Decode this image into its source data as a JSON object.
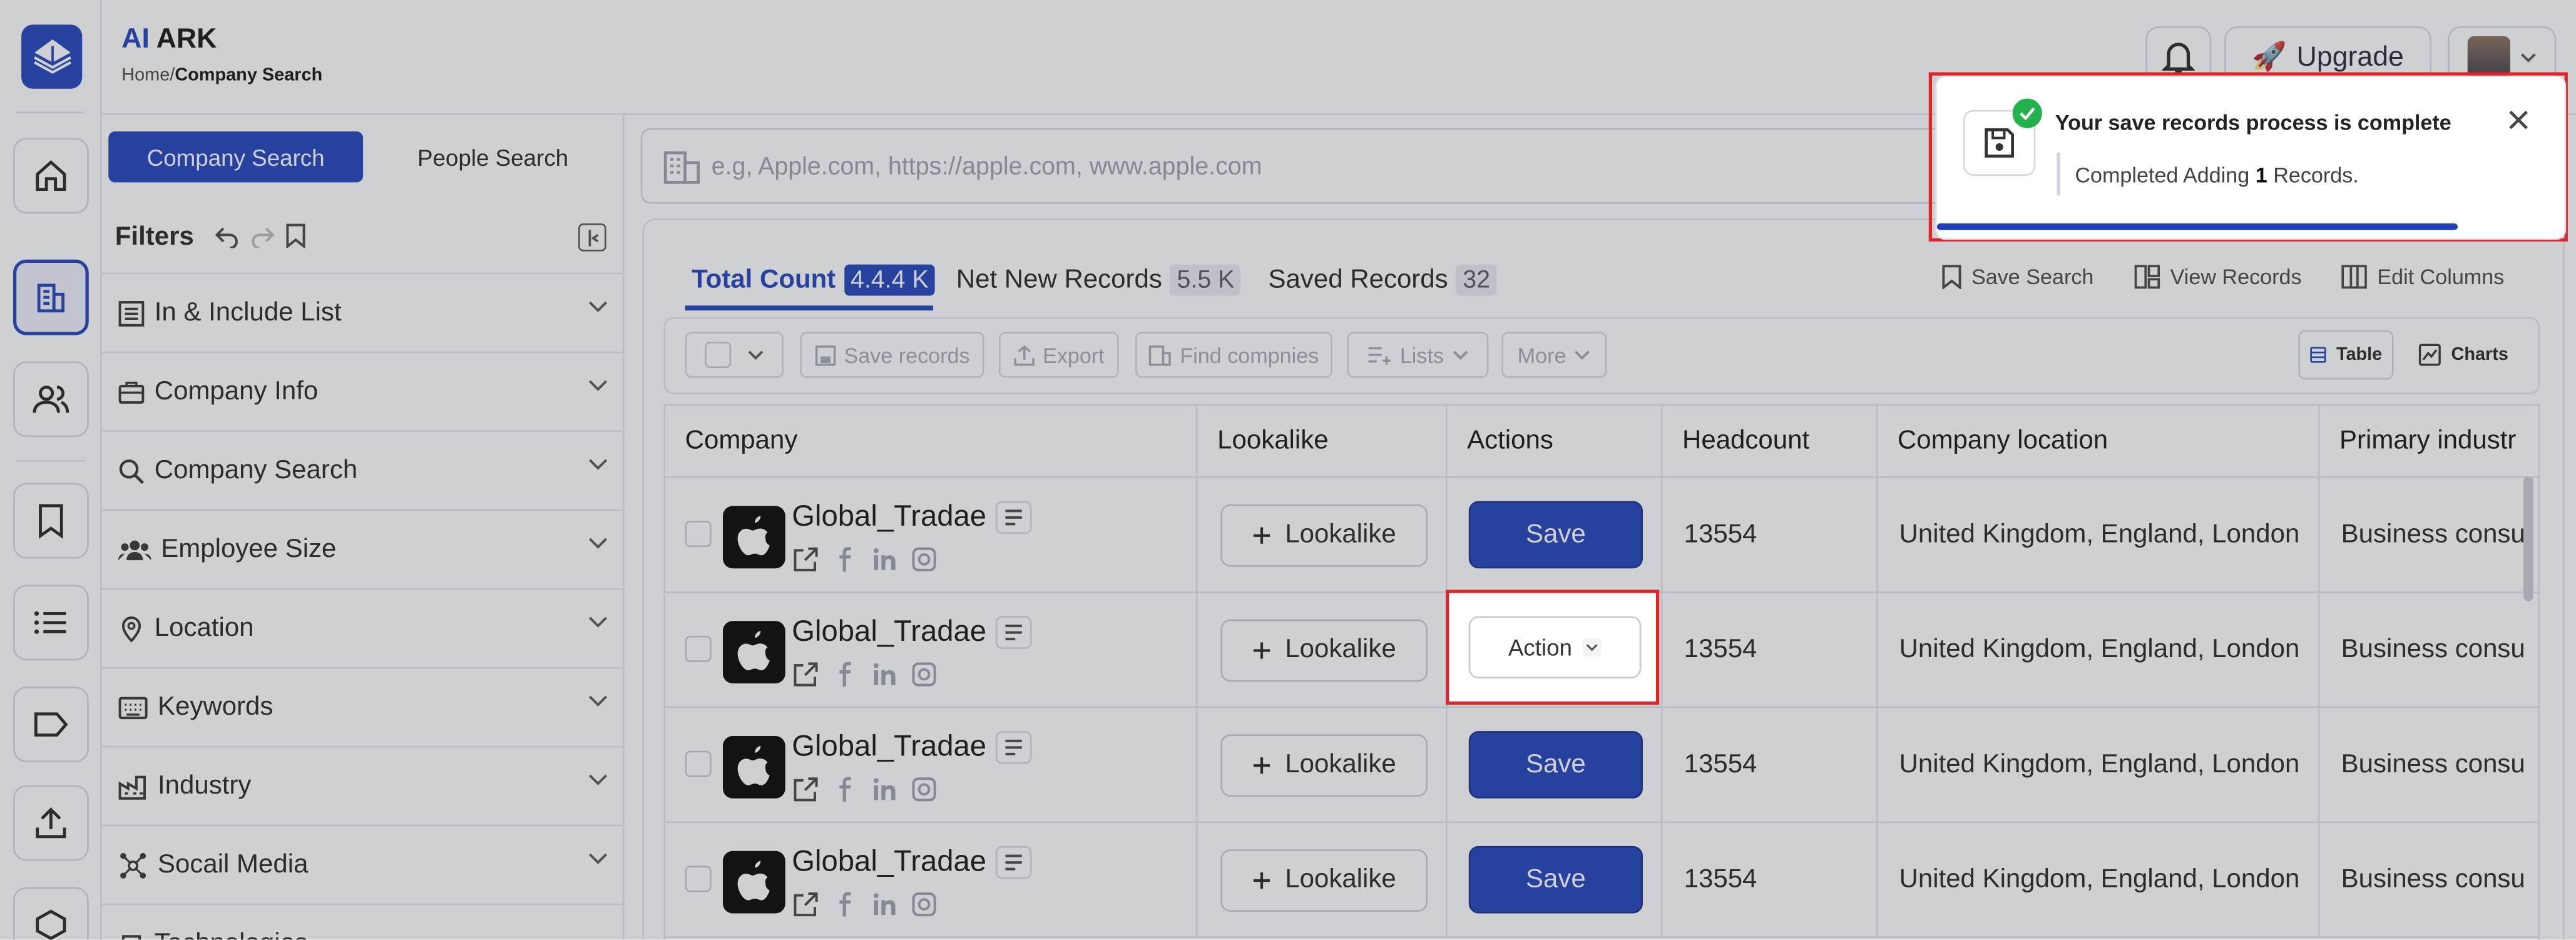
{
  "app": {
    "brand_ai": "AI",
    "brand_rest": " ARK"
  },
  "breadcrumb": {
    "home": "Home/",
    "current": "Company Search"
  },
  "header": {
    "upgrade_label": "Upgrade",
    "upgrade_emoji": "🚀"
  },
  "sidebar": {
    "tabs": [
      "Company Search",
      "People Search"
    ],
    "filters_title": "Filters",
    "filters": [
      {
        "label": "In & Include List",
        "icon": "list-icon"
      },
      {
        "label": "Company Info",
        "icon": "briefcase-icon"
      },
      {
        "label": "Company Search",
        "icon": "search-icon"
      },
      {
        "label": "Employee Size",
        "icon": "people-icon"
      },
      {
        "label": "Location",
        "icon": "location-pin-icon"
      },
      {
        "label": "Keywords",
        "icon": "keyboard-icon"
      },
      {
        "label": "Industry",
        "icon": "factory-icon"
      },
      {
        "label": "Socail Media",
        "icon": "network-icon"
      },
      {
        "label": "Technologies",
        "icon": "chip-icon"
      }
    ]
  },
  "search": {
    "placeholder": "e.g, Apple.com, https://apple.com, www.apple.com"
  },
  "tabs": [
    {
      "label": "Total Count",
      "badge": "4.4.4 K"
    },
    {
      "label": "Net New Records",
      "badge": "5.5 K"
    },
    {
      "label": "Saved Records",
      "badge": "32"
    }
  ],
  "top_links": {
    "save_search": "Save Search",
    "view_records": "View Records",
    "edit_columns": "Edit Columns"
  },
  "toolbar": {
    "save_records": "Save records",
    "export": "Export",
    "find_companies": "Find compnies",
    "lists": "Lists",
    "more": "More",
    "view_table": "Table",
    "view_charts": "Charts"
  },
  "table": {
    "columns": [
      "Company",
      "Lookalike",
      "Actions",
      "Headcount",
      "Company location",
      "Primary industr"
    ],
    "lookalike_label": "Lookalike",
    "rows": [
      {
        "company": "Global_Tradae",
        "action": "Save",
        "headcount": "13554",
        "location": "United Kingdom, England, London",
        "industry": "Business consu"
      },
      {
        "company": "Global_Tradae",
        "action": "Action",
        "headcount": "13554",
        "location": "United Kingdom, England, London",
        "industry": "Business consu"
      },
      {
        "company": "Global_Tradae",
        "action": "Save",
        "headcount": "13554",
        "location": "United Kingdom, England, London",
        "industry": "Business consu"
      },
      {
        "company": "Global_Tradae",
        "action": "Save",
        "headcount": "13554",
        "location": "United Kingdom, England, London",
        "industry": "Business consu"
      }
    ]
  },
  "toast": {
    "title": "Your save records process is complete",
    "message_prefix": "Completed Adding ",
    "message_count": "1",
    "message_suffix": " Records.",
    "progress": 0.83
  },
  "colors": {
    "accent": "#1d3fb8",
    "success": "#22b14c",
    "highlight": "#e0242c"
  }
}
